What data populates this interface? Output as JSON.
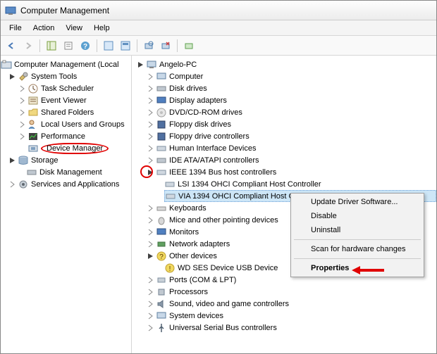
{
  "window": {
    "title": "Computer Management"
  },
  "menu": {
    "file": "File",
    "action": "Action",
    "view": "View",
    "help": "Help"
  },
  "left": {
    "root": "Computer Management (Local",
    "systools": "System Tools",
    "st": {
      "task": "Task Scheduler",
      "event": "Event Viewer",
      "shared": "Shared Folders",
      "users": "Local Users and Groups",
      "perf": "Performance",
      "devmgr": "Device Manager"
    },
    "storage": "Storage",
    "diskmgmt": "Disk Management",
    "services": "Services and Applications"
  },
  "right": {
    "root": "Angelo-PC",
    "items": {
      "computer": "Computer",
      "diskdrives": "Disk drives",
      "display": "Display adapters",
      "dvd": "DVD/CD-ROM drives",
      "floppydisk": "Floppy disk drives",
      "floppyctrl": "Floppy drive controllers",
      "hid": "Human Interface Devices",
      "ide": "IDE ATA/ATAPI controllers",
      "ieee": "IEEE 1394 Bus host controllers",
      "lsi": "LSI 1394 OHCI Compliant Host Controller",
      "via": "VIA 1394 OHCI Compliant Host Controller",
      "keyboards": "Keyboards",
      "mice": "Mice and other pointing devices",
      "monitors": "Monitors",
      "netadapters": "Network adapters",
      "other": "Other devices",
      "wd": "WD SES Device USB Device",
      "ports": "Ports (COM & LPT)",
      "processors": "Processors",
      "sound": "Sound, video and game controllers",
      "sysdev": "System devices",
      "usb": "Universal Serial Bus controllers"
    }
  },
  "ctx": {
    "update": "Update Driver Software...",
    "disable": "Disable",
    "uninstall": "Uninstall",
    "scan": "Scan for hardware changes",
    "props": "Properties"
  }
}
